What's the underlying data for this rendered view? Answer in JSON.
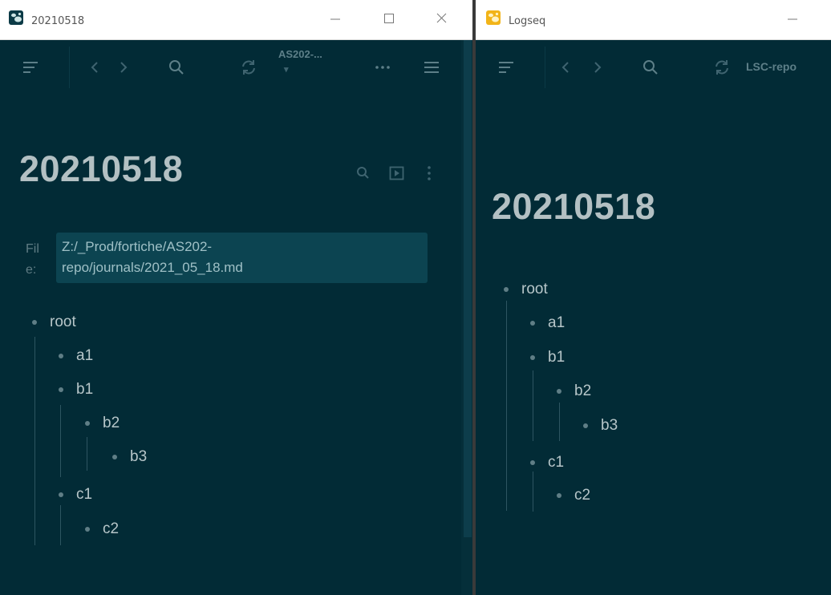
{
  "left_window": {
    "title": "20210518",
    "header": {
      "repo": "AS202-...",
      "repo_caret": "▾"
    },
    "page": {
      "title": "20210518",
      "file_label_line1": "Fil",
      "file_label_line2": "e:",
      "file_path_line1": "Z:/_Prod/fortiche/AS202-",
      "file_path_line2": "repo/journals/2021_05_18.md"
    },
    "blocks": {
      "root": "root",
      "a1": "a1",
      "b1": "b1",
      "b2": "b2",
      "b3": "b3",
      "c1": "c1",
      "c2": "c2"
    }
  },
  "right_window": {
    "title": "Logseq",
    "header": {
      "repo": "LSC-repo"
    },
    "page": {
      "title": "20210518"
    },
    "blocks": {
      "root": "root",
      "a1": "a1",
      "b1": "b1",
      "b2": "b2",
      "b3": "b3",
      "c1": "c1",
      "c2": "c2"
    }
  },
  "colors": {
    "background": "#022b36",
    "title_text": "#b3c0c3",
    "icon": "#5d7f88",
    "file_path_bg": "#0c4451"
  },
  "icons": [
    "menu-icon",
    "back-icon",
    "forward-icon",
    "search-icon",
    "sync-icon",
    "more-icon",
    "right-sidebar-icon",
    "presentation-icon",
    "page-menu-icon",
    "minimize-icon",
    "maximize-icon",
    "close-icon"
  ]
}
